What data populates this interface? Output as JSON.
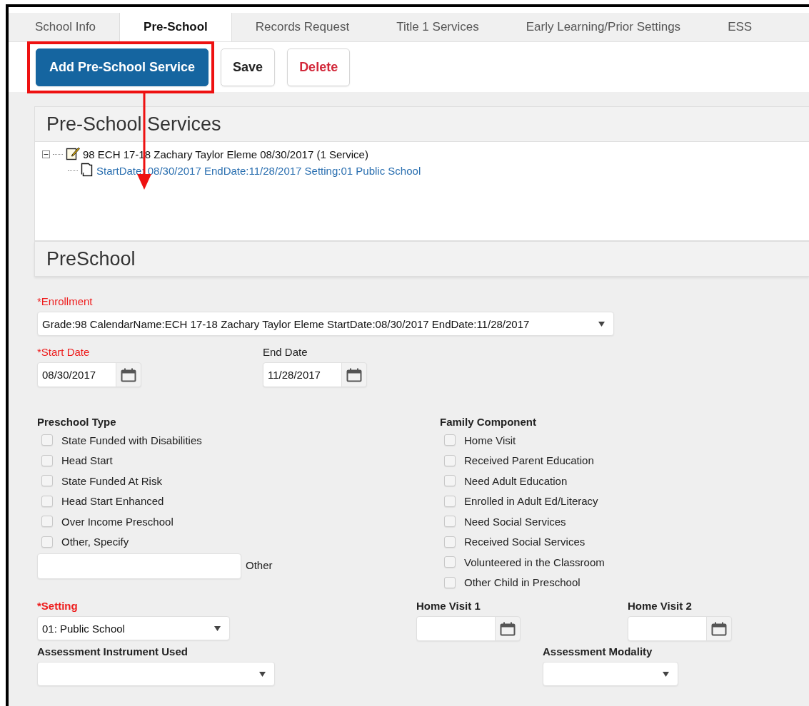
{
  "tabs": [
    {
      "label": "School Info",
      "selected": false
    },
    {
      "label": "Pre-School",
      "selected": true
    },
    {
      "label": "Records Request",
      "selected": false
    },
    {
      "label": "Title 1 Services",
      "selected": false
    },
    {
      "label": "Early Learning/Prior Settings",
      "selected": false
    },
    {
      "label": "ESS",
      "selected": false
    }
  ],
  "toolbar": {
    "buttons": [
      {
        "label": "Add Pre-School Service",
        "kind": "primary"
      },
      {
        "label": "Save",
        "kind": "default"
      },
      {
        "label": "Delete",
        "kind": "danger"
      }
    ]
  },
  "services_panel": {
    "title": "Pre-School Services",
    "tree": [
      {
        "label": "98 ECH 17-18 Zachary Taylor Eleme 08/30/2017 (1 Service)",
        "expanded": true,
        "children": [
          {
            "label": "StartDate: 08/30/2017 EndDate:11/28/2017 Setting:01 Public School"
          }
        ]
      }
    ]
  },
  "form": {
    "title": "PreSchool",
    "enrollment": {
      "label": "*Enrollment",
      "required": true,
      "value": "Grade:98 CalendarName:ECH 17-18 Zachary Taylor Eleme StartDate:08/30/2017 EndDate:11/28/2017"
    },
    "start_date": {
      "label": "*Start Date",
      "required": true,
      "value": "08/30/2017"
    },
    "end_date": {
      "label": "End Date",
      "required": false,
      "value": "11/28/2017"
    },
    "preschool_type": {
      "title": "Preschool Type",
      "options": [
        {
          "label": "State Funded with Disabilities",
          "checked": false
        },
        {
          "label": "Head Start",
          "checked": false
        },
        {
          "label": "State Funded At Risk",
          "checked": false
        },
        {
          "label": "Head Start Enhanced",
          "checked": false
        },
        {
          "label": "Over Income Preschool",
          "checked": false
        },
        {
          "label": "Other, Specify",
          "checked": false
        }
      ]
    },
    "other": {
      "label": "Other"
    },
    "family_component": {
      "title": "Family Component",
      "options": [
        {
          "label": "Home Visit",
          "checked": false
        },
        {
          "label": "Received Parent Education",
          "checked": false
        },
        {
          "label": "Need Adult Education",
          "checked": false
        },
        {
          "label": "Enrolled in Adult Ed/Literacy",
          "checked": false
        },
        {
          "label": "Need Social Services",
          "checked": false
        },
        {
          "label": "Received Social Services",
          "checked": false
        },
        {
          "label": "Volunteered in the Classroom",
          "checked": false
        },
        {
          "label": "Other Child in Preschool",
          "checked": false
        }
      ]
    },
    "setting": {
      "label": "*Setting",
      "required": true,
      "value": "01: Public School"
    },
    "home_visit_1": {
      "label": "Home Visit 1",
      "required": false
    },
    "home_visit_2": {
      "label": "Home Visit 2",
      "required": false
    },
    "assessment_instrument": {
      "label": "Assessment Instrument Used",
      "required": false
    },
    "assessment_modality": {
      "label": "Assessment Modality",
      "required": false
    }
  }
}
